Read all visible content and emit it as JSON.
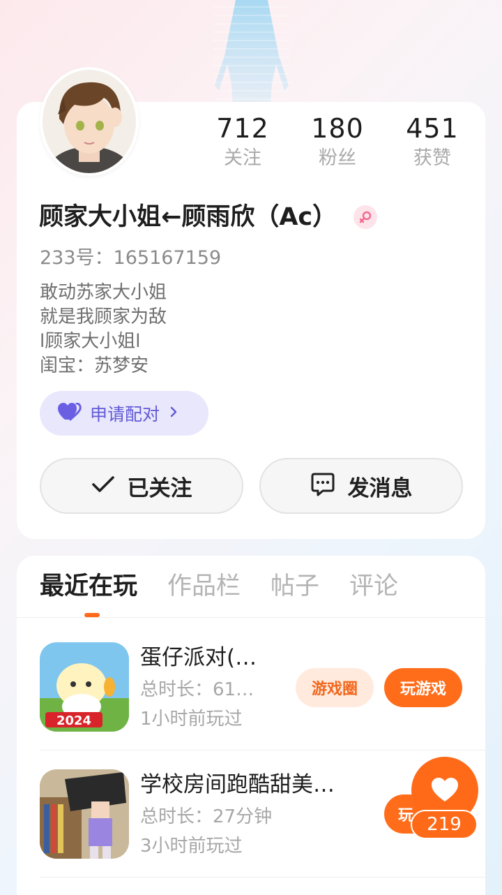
{
  "stats": [
    {
      "value": "712",
      "label": "关注"
    },
    {
      "value": "180",
      "label": "粉丝"
    },
    {
      "value": "451",
      "label": "获赞"
    }
  ],
  "profile": {
    "name": "顾家大小姐←顾雨欣（Ac）",
    "uid": "233号：165167159",
    "bio": [
      "敢动苏家大小姐",
      "就是我顾家为敌",
      "l顾家大小姐l",
      "闺宝：苏梦安"
    ],
    "pair_label": "申请配对"
  },
  "actions": {
    "follow_label": "已关注",
    "message_label": "发消息"
  },
  "tabs": [
    {
      "label": "最近在玩",
      "active": true
    },
    {
      "label": "作品栏",
      "active": false
    },
    {
      "label": "帖子",
      "active": false
    },
    {
      "label": "评论",
      "active": false
    }
  ],
  "games": [
    {
      "title": "蛋仔派对(…",
      "duration": "总时长：61…",
      "last_played": "1小时前玩过",
      "circle_label": "游戏圈",
      "play_label": "玩游戏"
    },
    {
      "title": "学校房间跑酷甜美…",
      "duration": "总时长：27分钟",
      "last_played": "3小时前玩过",
      "play_label": "玩"
    }
  ],
  "like_fab": {
    "count": "219"
  },
  "colors": {
    "accent": "#ff6a18",
    "pair_text": "#6259d6",
    "pair_bg": "#e8e7fb"
  }
}
